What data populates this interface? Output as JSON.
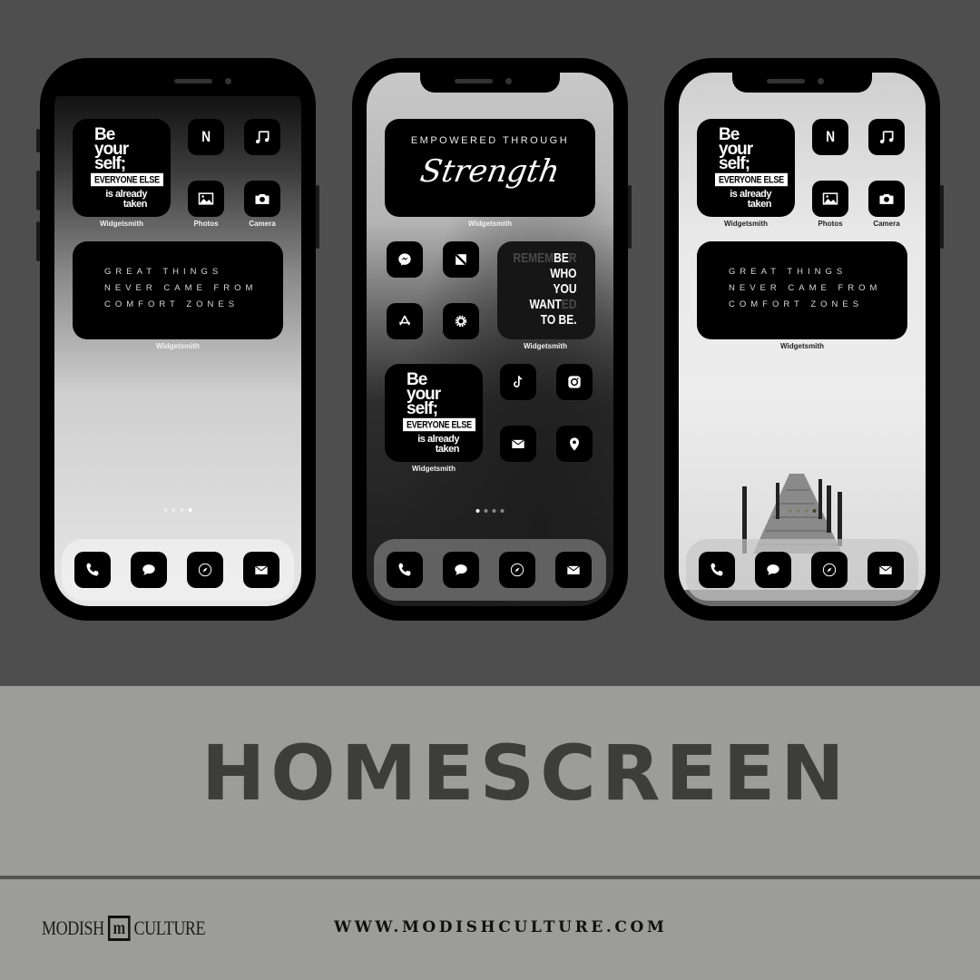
{
  "page": {
    "title": "HOMESCREEN",
    "brand": {
      "left": "MODISH",
      "mark": "m",
      "right": "CULTURE"
    },
    "url": "WWW.MODISHCULTURE.COM",
    "colors": {
      "top_band": "#4e4e4e",
      "bottom_band": "#9c9c9a",
      "title_text": "#3d3d3b",
      "icon_bg": "#000000"
    }
  },
  "phones": [
    {
      "id": "phone-1",
      "widgets": {
        "be_yourself": {
          "line1": "Be",
          "line2": "your",
          "line3": "self;",
          "box": "EVERYONE ELSE",
          "line4": "is already",
          "line5": "taken",
          "label": "Widgetsmith"
        },
        "great_things": {
          "lines": [
            "GREAT THINGS",
            "NEVER CAME FROM",
            "COMFORT ZONES"
          ],
          "label": "Widgetsmith"
        }
      },
      "apps": [
        {
          "name": "Netflix",
          "icon": "netflix-icon",
          "glyph": "N",
          "label": ""
        },
        {
          "name": "Music",
          "icon": "music-icon",
          "label": ""
        },
        {
          "name": "Photos",
          "icon": "photos-icon",
          "label": "Photos"
        },
        {
          "name": "Camera",
          "icon": "camera-icon",
          "label": "Camera"
        }
      ],
      "page_dots": {
        "count": 4,
        "active": 4
      },
      "dock": [
        "phone-icon",
        "messages-icon",
        "safari-icon",
        "mail-icon"
      ]
    },
    {
      "id": "phone-2",
      "widgets": {
        "empowered": {
          "line1": "EMPOWERED THROUGH",
          "line2": "Strength",
          "label": "Widgetsmith"
        },
        "remember": {
          "lines": [
            [
              "REMEM",
              "BE",
              "R"
            ],
            [
              "",
              "WHO",
              ""
            ],
            [
              "",
              "YOU",
              ""
            ],
            [
              "",
              "WANT",
              "ED"
            ],
            [
              "",
              "TO BE.",
              ""
            ]
          ],
          "label": "Widgetsmith"
        },
        "be_yourself": {
          "line1": "Be",
          "line2": "your",
          "line3": "self;",
          "box": "EVERYONE ELSE",
          "line4": "is already",
          "line5": "taken",
          "label": "Widgetsmith"
        }
      },
      "apps": [
        {
          "name": "Messenger",
          "icon": "messenger-icon"
        },
        {
          "name": "News",
          "icon": "news-icon"
        },
        {
          "name": "App Store",
          "icon": "app-store-icon"
        },
        {
          "name": "Settings",
          "icon": "settings-icon"
        },
        {
          "name": "TikTok",
          "icon": "tiktok-icon"
        },
        {
          "name": "Instagram",
          "icon": "instagram-icon"
        },
        {
          "name": "Mail",
          "icon": "mail-icon"
        },
        {
          "name": "Maps",
          "icon": "location-pin-icon"
        }
      ],
      "page_dots": {
        "count": 4,
        "active": 1
      },
      "dock": [
        "phone-icon",
        "messages-icon",
        "safari-icon",
        "mail-icon"
      ]
    },
    {
      "id": "phone-3",
      "widgets": {
        "be_yourself": {
          "line1": "Be",
          "line2": "your",
          "line3": "self;",
          "box": "EVERYONE ELSE",
          "line4": "is already",
          "line5": "taken",
          "label": "Widgetsmith"
        },
        "great_things": {
          "lines": [
            "GREAT THINGS",
            "NEVER CAME FROM",
            "COMFORT ZONES"
          ],
          "label": "Widgetsmith"
        }
      },
      "apps": [
        {
          "name": "Netflix",
          "icon": "netflix-icon",
          "glyph": "N",
          "label": ""
        },
        {
          "name": "Music",
          "icon": "music-icon",
          "label": ""
        },
        {
          "name": "Photos",
          "icon": "photos-icon",
          "label": "Photos"
        },
        {
          "name": "Camera",
          "icon": "camera-icon",
          "label": "Camera"
        }
      ],
      "page_dots": {
        "count": 4,
        "active": 4
      },
      "dock": [
        "phone-icon",
        "messages-icon",
        "safari-icon",
        "mail-icon"
      ]
    }
  ]
}
